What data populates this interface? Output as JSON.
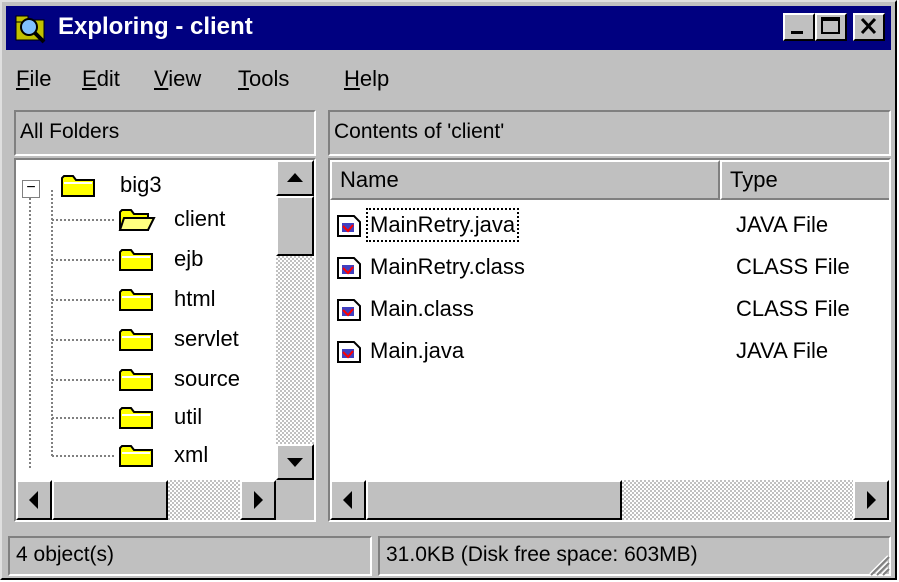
{
  "window": {
    "title": "Exploring - client",
    "icon": "explorer-icon",
    "controls": [
      "minimize",
      "maximize",
      "close"
    ]
  },
  "menu": {
    "file": {
      "mnemonic": "F",
      "rest": "ile"
    },
    "edit": {
      "mnemonic": "E",
      "rest": "dit"
    },
    "view": {
      "mnemonic": "V",
      "rest": "iew"
    },
    "tools": {
      "mnemonic": "T",
      "rest": "ools"
    },
    "help": {
      "mnemonic": "H",
      "rest": "elp"
    }
  },
  "left_header": "All Folders",
  "right_header": "Contents of 'client'",
  "tree": {
    "root": {
      "label": "big3",
      "expander": "−"
    },
    "children": [
      "client",
      "ejb",
      "html",
      "servlet",
      "source",
      "util",
      "xml"
    ],
    "selected": "client"
  },
  "list": {
    "columns": [
      "Name",
      "Type"
    ],
    "rows": [
      {
        "name": "MainRetry.java",
        "type": "JAVA File"
      },
      {
        "name": "MainRetry.class",
        "type": "CLASS File"
      },
      {
        "name": "Main.class",
        "type": "CLASS File"
      },
      {
        "name": "Main.java",
        "type": "JAVA File"
      }
    ],
    "focused_row": 0
  },
  "status": {
    "objects": "4 object(s)",
    "size": "31.0KB (Disk free space: 603MB)"
  },
  "colors": {
    "title_bg": "#000080",
    "face": "#c0c0c0",
    "folder": "#ffff00"
  }
}
